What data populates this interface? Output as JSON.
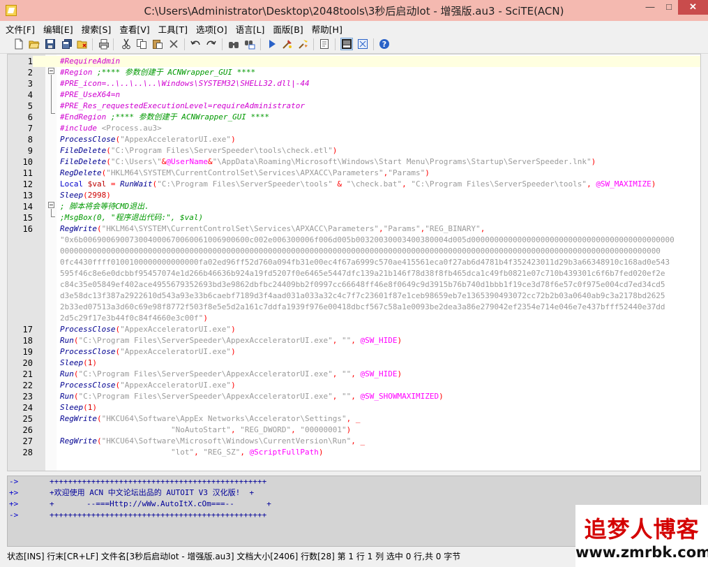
{
  "window": {
    "title": "C:\\Users\\Administrator\\Desktop\\2048tools\\3秒后启动lot - 增强版.au3 - SciTE(ACN)",
    "min_glyph": "—",
    "max_glyph": "□",
    "close_glyph": "✕"
  },
  "menu": [
    "文件[F]",
    "编辑[E]",
    "搜索[S]",
    "查看[V]",
    "工具[T]",
    "选项[O]",
    "语言[L]",
    "面版[B]",
    "帮助[H]"
  ],
  "toolbar_icons": [
    "new-icon",
    "open-icon",
    "save-icon",
    "save-all-icon",
    "close-file-icon",
    "print-icon",
    "cut-icon",
    "copy-icon",
    "paste-icon",
    "delete-icon",
    "undo-icon",
    "redo-icon",
    "find-icon",
    "replace-icon",
    "run-icon",
    "compile-icon",
    "tidy-icon",
    "properties-icon",
    "output-pane-icon",
    "fullscreen-icon",
    "help-icon"
  ],
  "editor": {
    "lines": [
      {
        "n": "1",
        "segs": [
          [
            "dir",
            "#RequireAdmin"
          ]
        ]
      },
      {
        "n": "2",
        "segs": [
          [
            "dir",
            "#Region "
          ],
          [
            "cmt",
            ";**** 参数创建于 ACNWrapper_GUI ****"
          ]
        ]
      },
      {
        "n": "3",
        "segs": [
          [
            "dir",
            "#PRE_icon=..\\..\\..\\..\\Windows\\SYSTEM32\\SHELL32.dll|-44"
          ]
        ]
      },
      {
        "n": "4",
        "segs": [
          [
            "dir",
            "#PRE_UseX64=n"
          ]
        ]
      },
      {
        "n": "5",
        "segs": [
          [
            "dir",
            "#PRE_Res_requestedExecutionLevel=requireAdministrator"
          ]
        ]
      },
      {
        "n": "6",
        "segs": [
          [
            "dir",
            "#EndRegion "
          ],
          [
            "cmt",
            ";**** 参数创建于 ACNWrapper_GUI ****"
          ]
        ]
      },
      {
        "n": "7",
        "segs": [
          [
            "inc",
            "#include "
          ],
          [
            "incs",
            "<Process.au3>"
          ]
        ]
      },
      {
        "n": "8",
        "segs": [
          [
            "fn",
            "ProcessClose"
          ],
          [
            "op",
            "("
          ],
          [
            "str",
            "\"AppexAcceleratorUI.exe\""
          ],
          [
            "op",
            ")"
          ]
        ]
      },
      {
        "n": "9",
        "segs": [
          [
            "fn",
            "FileDelete"
          ],
          [
            "op",
            "("
          ],
          [
            "str",
            "\"C:\\Program Files\\ServerSpeeder\\tools\\check.etl\""
          ],
          [
            "op",
            ")"
          ]
        ]
      },
      {
        "n": "10",
        "segs": [
          [
            "fn",
            "FileDelete"
          ],
          [
            "op",
            "("
          ],
          [
            "str",
            "\"C:\\Users\\\""
          ],
          [
            "op",
            "&"
          ],
          [
            "mac",
            "@UserName"
          ],
          [
            "op",
            "&"
          ],
          [
            "str",
            "\"\\AppData\\Roaming\\Microsoft\\Windows\\Start Menu\\Programs\\Startup\\ServerSpeeder.lnk\""
          ],
          [
            "op",
            ")"
          ]
        ]
      },
      {
        "n": "11",
        "segs": [
          [
            "fn",
            "RegDelete"
          ],
          [
            "op",
            "("
          ],
          [
            "str",
            "\"HKLM64\\SYSTEM\\CurrentControlSet\\Services\\APXACC\\Parameters\""
          ],
          [
            "op",
            ","
          ],
          [
            "str",
            "\"Params\""
          ],
          [
            "op",
            ")"
          ]
        ]
      },
      {
        "n": "12",
        "segs": [
          [
            "kw",
            "Local "
          ],
          [
            "var",
            "$val"
          ],
          [
            "op",
            " = "
          ],
          [
            "fn",
            "RunWait"
          ],
          [
            "op",
            "("
          ],
          [
            "str",
            "\"C:\\Program Files\\ServerSpeeder\\tools\""
          ],
          [
            "op",
            " & "
          ],
          [
            "str",
            "\"\\check.bat\""
          ],
          [
            "op",
            ", "
          ],
          [
            "str",
            "\"C:\\Program Files\\ServerSpeeder\\tools\""
          ],
          [
            "op",
            ", "
          ],
          [
            "mac",
            "@SW_MAXIMIZE"
          ],
          [
            "op",
            ")"
          ]
        ]
      },
      {
        "n": "13",
        "segs": [
          [
            "fn",
            "Sleep"
          ],
          [
            "op",
            "("
          ],
          [
            "num",
            "2998"
          ],
          [
            "op",
            ")"
          ]
        ]
      },
      {
        "n": "14",
        "segs": [
          [
            "cmt",
            "; 脚本将会等待CMD退出."
          ]
        ]
      },
      {
        "n": "15",
        "segs": [
          [
            "cmt",
            ";MsgBox(0, \"程序退出代码:\", $val)"
          ]
        ]
      },
      {
        "n": "16",
        "segs": [
          [
            "fn",
            "RegWrite"
          ],
          [
            "op",
            "("
          ],
          [
            "str",
            "\"HKLM64\\SYSTEM\\CurrentControlSet\\Services\\APXACC\\Parameters\""
          ],
          [
            "op",
            ","
          ],
          [
            "str",
            "\"Params\""
          ],
          [
            "op",
            ","
          ],
          [
            "str",
            "\"REG_BINARY\""
          ],
          [
            "op",
            ","
          ]
        ]
      },
      {
        "n": "",
        "segs": [
          [
            "str",
            "\"0x6b006900690073004000670060061006900600c002e006300006f006d005b00320030003400380004d005d00000000000000000000000000000000000000000000"
          ]
        ]
      },
      {
        "n": "",
        "segs": [
          [
            "str",
            "0000000000000000000000000000000000000000000000000000000000000000000000000000000000000000000000000000000000000000000000000000000000"
          ]
        ]
      },
      {
        "n": "",
        "segs": [
          [
            "str",
            "0fc4430ffff0100100000000000000fa02ed96ff52d760a094fb31e00ec4f67a6999c570ae415561eca0f27ab6d4781b4f352423011d29b3a66348910c168ad0e543"
          ]
        ]
      },
      {
        "n": "",
        "segs": [
          [
            "str",
            "595f46c8e6e0dcbbf95457074e1d266b46636b924a19fd5207f0e6465e5447dfc139a21b146f78d38f8fb465dca1c49fb0821e07c710b439301c6f6b7fed020ef2e"
          ]
        ]
      },
      {
        "n": "",
        "segs": [
          [
            "str",
            "c84c35e05849ef402ace4955679352693bd3e9862dbfbc24409bb2f0997cc66648ff46e8f0649c9d3915b76b740d1bbb1f19ce3d78f6e57c0f975e004cd7ed34cd5"
          ]
        ]
      },
      {
        "n": "",
        "segs": [
          [
            "str",
            "d3e58dc13f387a2922610d543a93e33b6caebf7189d3f4aad031a033a32c4c7f7c23601f87e1ceb98659eb7e1365390493072cc72b2b03a0640ab9c3a2178bd2625"
          ]
        ]
      },
      {
        "n": "",
        "segs": [
          [
            "str",
            "2b33ed07513a3d60c69e98f8772f503f8e5e5d2a161c7ddfa1939f976e00418dbcf567c58a1e0093be2dea3a86e279042ef2354e714e046e7e437bfff52440e37dd"
          ]
        ]
      },
      {
        "n": "",
        "segs": [
          [
            "str",
            "2d5c29f17e3b44f0c84f4660e3c00f\""
          ],
          [
            "op",
            ")"
          ]
        ]
      },
      {
        "n": "17",
        "segs": [
          [
            "fn",
            "ProcessClose"
          ],
          [
            "op",
            "("
          ],
          [
            "str",
            "\"AppexAcceleratorUI.exe\""
          ],
          [
            "op",
            ")"
          ]
        ]
      },
      {
        "n": "18",
        "segs": [
          [
            "fn",
            "Run"
          ],
          [
            "op",
            "("
          ],
          [
            "str",
            "\"C:\\Program Files\\ServerSpeeder\\AppexAcceleratorUI.exe\""
          ],
          [
            "op",
            ", "
          ],
          [
            "str",
            "\"\""
          ],
          [
            "op",
            ", "
          ],
          [
            "mac",
            "@SW_HIDE"
          ],
          [
            "op",
            ")"
          ]
        ]
      },
      {
        "n": "19",
        "segs": [
          [
            "fn",
            "ProcessClose"
          ],
          [
            "op",
            "("
          ],
          [
            "str",
            "\"AppexAcceleratorUI.exe\""
          ],
          [
            "op",
            ")"
          ]
        ]
      },
      {
        "n": "20",
        "segs": [
          [
            "fn",
            "Sleep"
          ],
          [
            "op",
            "("
          ],
          [
            "num",
            "1"
          ],
          [
            "op",
            ")"
          ]
        ]
      },
      {
        "n": "21",
        "segs": [
          [
            "fn",
            "Run"
          ],
          [
            "op",
            "("
          ],
          [
            "str",
            "\"C:\\Program Files\\ServerSpeeder\\AppexAcceleratorUI.exe\""
          ],
          [
            "op",
            ", "
          ],
          [
            "str",
            "\"\""
          ],
          [
            "op",
            ", "
          ],
          [
            "mac",
            "@SW_HIDE"
          ],
          [
            "op",
            ")"
          ]
        ]
      },
      {
        "n": "22",
        "segs": [
          [
            "fn",
            "ProcessClose"
          ],
          [
            "op",
            "("
          ],
          [
            "str",
            "\"AppexAcceleratorUI.exe\""
          ],
          [
            "op",
            ")"
          ]
        ]
      },
      {
        "n": "23",
        "segs": [
          [
            "fn",
            "Run"
          ],
          [
            "op",
            "("
          ],
          [
            "str",
            "\"C:\\Program Files\\ServerSpeeder\\AppexAcceleratorUI.exe\""
          ],
          [
            "op",
            ", "
          ],
          [
            "str",
            "\"\""
          ],
          [
            "op",
            ", "
          ],
          [
            "mac",
            "@SW_SHOWMAXIMIZED"
          ],
          [
            "op",
            ")"
          ]
        ]
      },
      {
        "n": "24",
        "segs": [
          [
            "fn",
            "Sleep"
          ],
          [
            "op",
            "("
          ],
          [
            "num",
            "1"
          ],
          [
            "op",
            ")"
          ]
        ]
      },
      {
        "n": "25",
        "segs": [
          [
            "fn",
            "RegWrite"
          ],
          [
            "op",
            "("
          ],
          [
            "str",
            "\"HKCU64\\Software\\AppEx Networks\\Accelerator\\Settings\""
          ],
          [
            "op",
            ", _"
          ]
        ]
      },
      {
        "n": "26",
        "segs": [
          [
            "blk",
            "                        "
          ],
          [
            "str",
            "\"NoAutoStart\""
          ],
          [
            "op",
            ", "
          ],
          [
            "str",
            "\"REG_DWORD\""
          ],
          [
            "op",
            ", "
          ],
          [
            "str",
            "\"00000001\""
          ],
          [
            "op",
            ")"
          ]
        ]
      },
      {
        "n": "27",
        "segs": [
          [
            "fn",
            "RegWrite"
          ],
          [
            "op",
            "("
          ],
          [
            "str",
            "\"HKCU64\\Software\\Microsoft\\Windows\\CurrentVersion\\Run\""
          ],
          [
            "op",
            ", _"
          ]
        ]
      },
      {
        "n": "28",
        "segs": [
          [
            "blk",
            "                        "
          ],
          [
            "str",
            "\"lot\""
          ],
          [
            "op",
            ", "
          ],
          [
            "str",
            "\"REG_SZ\""
          ],
          [
            "op",
            ", "
          ],
          [
            "mac",
            "@ScriptFullPath"
          ],
          [
            "op",
            ")"
          ]
        ]
      }
    ]
  },
  "output": {
    "lines": [
      {
        "pre": "->",
        "txt": "+++++++++++++++++++++++++++++++++++++++++++++++"
      },
      {
        "pre": "+>",
        "txt": "+欢迎使用 ACN 中文论坛出品的 AUTOIT V3 汉化版!  +"
      },
      {
        "pre": "+>",
        "txt": "+       --===Http://wWw.AutoItX.cOm===--       +"
      },
      {
        "pre": "->",
        "txt": "+++++++++++++++++++++++++++++++++++++++++++++++"
      }
    ]
  },
  "statusbar": {
    "text": "状态[INS] 行末[CR+LF] 文件名[3秒后启动lot - 增强版.au3] 文档大小[2406] 行数[28] 第 1 行 1 列 选中 0 行,共 0 字节"
  },
  "watermark": {
    "title": "追梦人博客",
    "url": "www.zmrbk.com"
  },
  "colors": {
    "titlebar": "#f4b9b0",
    "close_button": "#c94c4c",
    "current_line": "#ffffe0",
    "directive": "#d000d0",
    "comment": "#009900",
    "function": "#000090",
    "string": "#9a9a9a",
    "operator": "#ff0000",
    "macro": "#ff00ff"
  }
}
